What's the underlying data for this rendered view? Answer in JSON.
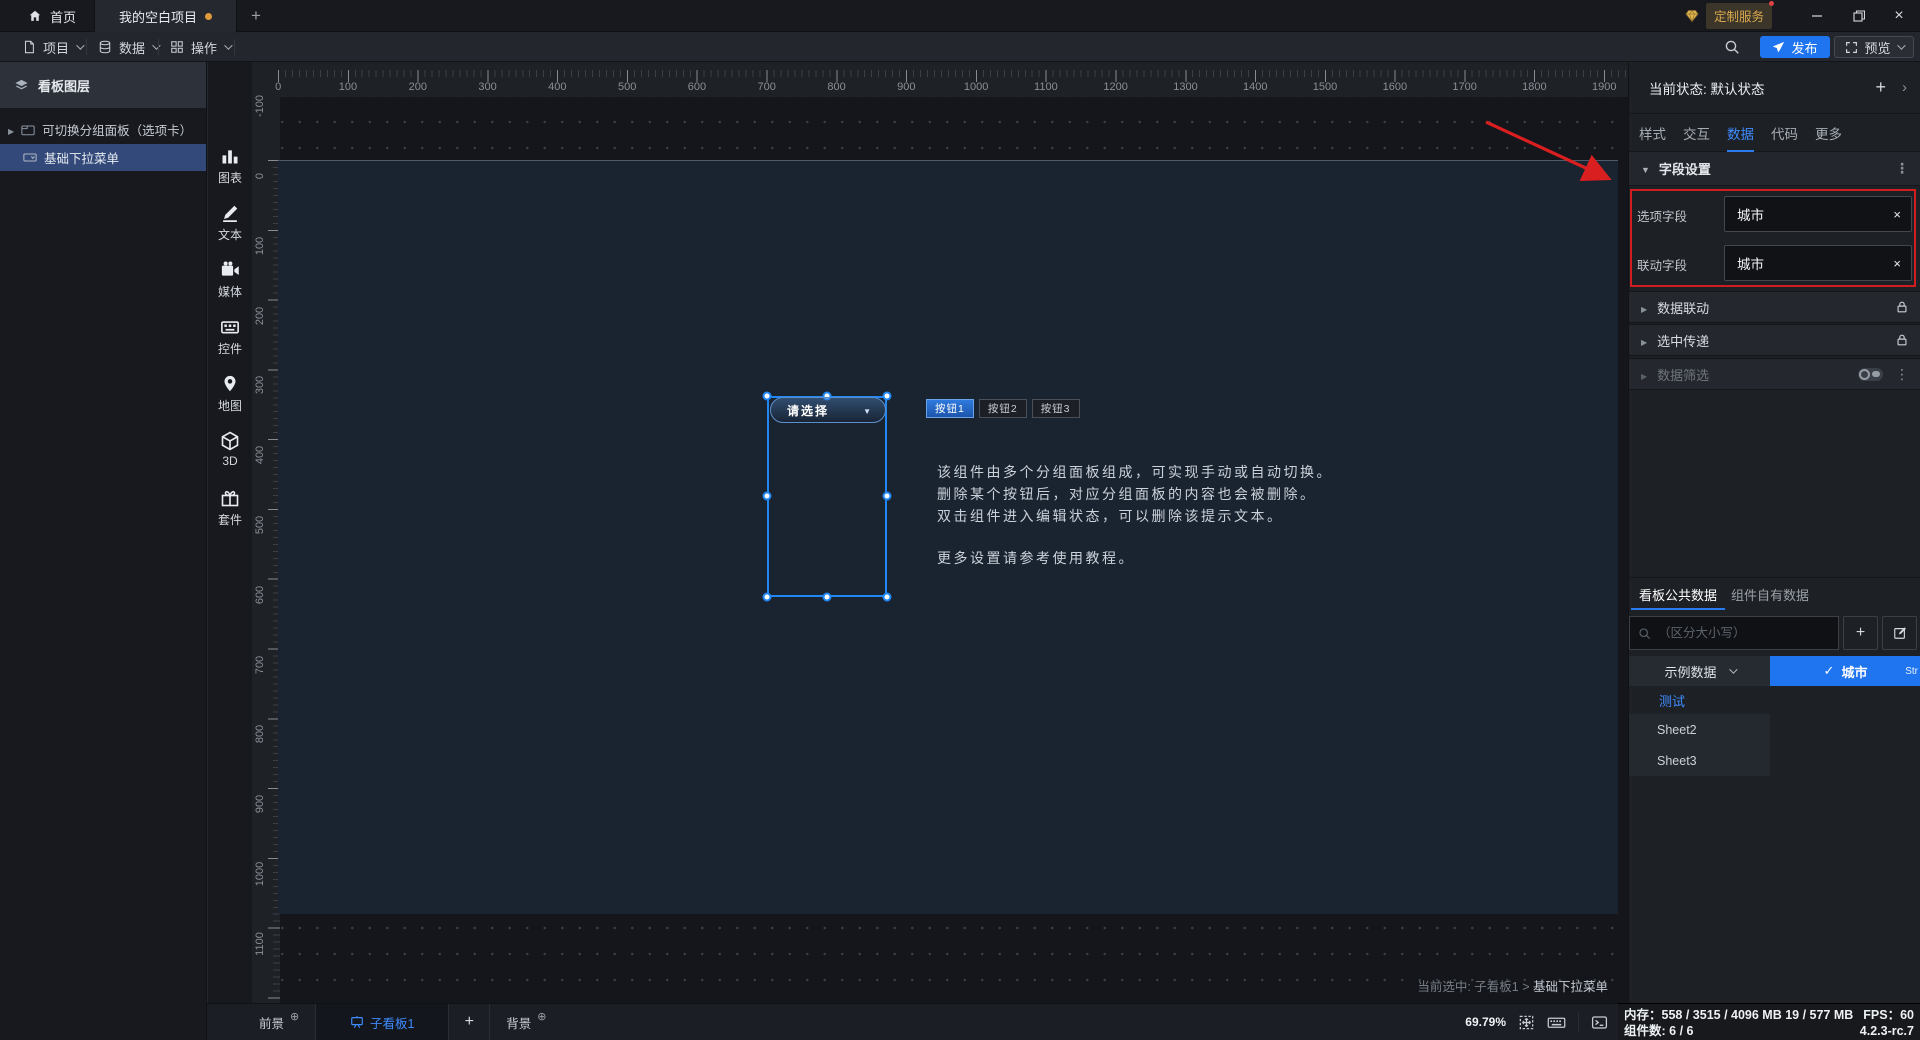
{
  "title_bar": {
    "home_label": "首页",
    "project_tab": "我的空白项目",
    "custom_service": "定制服务"
  },
  "toolbar": {
    "menus": [
      {
        "label": "项目"
      },
      {
        "label": "数据"
      },
      {
        "label": "操作"
      }
    ],
    "publish_label": "发布",
    "preview_label": "预览"
  },
  "layers_panel": {
    "header": "看板图层",
    "items": [
      {
        "label": "可切换分组面板（选项卡）",
        "selected": false
      },
      {
        "label": "基础下拉菜单",
        "selected": true
      }
    ]
  },
  "component_dock": {
    "items": [
      {
        "label": "图表"
      },
      {
        "label": "文本"
      },
      {
        "label": "媒体"
      },
      {
        "label": "控件"
      },
      {
        "label": "地图"
      },
      {
        "label": "3D"
      },
      {
        "label": "套件"
      }
    ]
  },
  "canvas": {
    "h_ruler_labels": [
      0,
      100,
      200,
      300,
      400,
      500,
      600,
      700,
      800,
      900,
      1000,
      1100,
      1200,
      1300,
      1400,
      1500,
      1600,
      1700,
      1800,
      1900
    ],
    "v_ruler_labels": [
      -100,
      0,
      100,
      200,
      300,
      400,
      500,
      600,
      700,
      800,
      900,
      1000,
      1100
    ],
    "dropdown_placeholder": "请选择",
    "group_buttons": [
      {
        "label": "按钮1",
        "active": true
      },
      {
        "label": "按钮2",
        "active": false
      },
      {
        "label": "按钮3",
        "active": false
      }
    ],
    "description_lines": [
      "该组件由多个分组面板组成，可实现手动或自动切换。",
      "删除某个按钮后，对应分组面板的内容也会被删除。",
      "双击组件进入编辑状态，可以删除该提示文本。",
      "更多设置请参考使用教程。"
    ],
    "selected_info_prefix": "当前选中: 子看板1 > ",
    "selected_info_name": "基础下拉菜单"
  },
  "bottom_bar": {
    "foreground_label": "前景",
    "subboard_tab": "子看板1",
    "background_label": "背景",
    "zoom_percent": "69.79%"
  },
  "inspector": {
    "state_label": "当前状态: 默认状态",
    "tabs": [
      {
        "label": "样式",
        "active": false
      },
      {
        "label": "交互",
        "active": false
      },
      {
        "label": "数据",
        "active": true
      },
      {
        "label": "代码",
        "active": false
      },
      {
        "label": "更多",
        "active": false
      }
    ],
    "field_section_title": "字段设置",
    "fields": [
      {
        "label": "选项字段",
        "value": "城市"
      },
      {
        "label": "联动字段",
        "value": "城市"
      }
    ],
    "sections": [
      {
        "label": "数据联动",
        "locked": true
      },
      {
        "label": "选中传递",
        "locked": true
      },
      {
        "label": "数据筛选",
        "disabled": true
      }
    ]
  },
  "data_panel": {
    "tabs": [
      {
        "label": "看板公共数据",
        "active": true
      },
      {
        "label": "组件自有数据",
        "active": false
      }
    ],
    "search_placeholder": "（区分大小写）",
    "source_select": "示例数据",
    "selected_field": "城市",
    "selected_field_type": "Str",
    "sheets": [
      {
        "label": "测试",
        "active": true
      },
      {
        "label": "Sheet2",
        "active": false
      },
      {
        "label": "Sheet3",
        "active": false
      }
    ]
  },
  "status_bar": {
    "memory_label": "内存：",
    "memory_value": "558 / 3515 / 4096 MB 19 / 577 MB",
    "fps": "FPS：60",
    "components_label": "组件数:",
    "components_value": "6 / 6",
    "version": "4.2.3-rc.7"
  }
}
